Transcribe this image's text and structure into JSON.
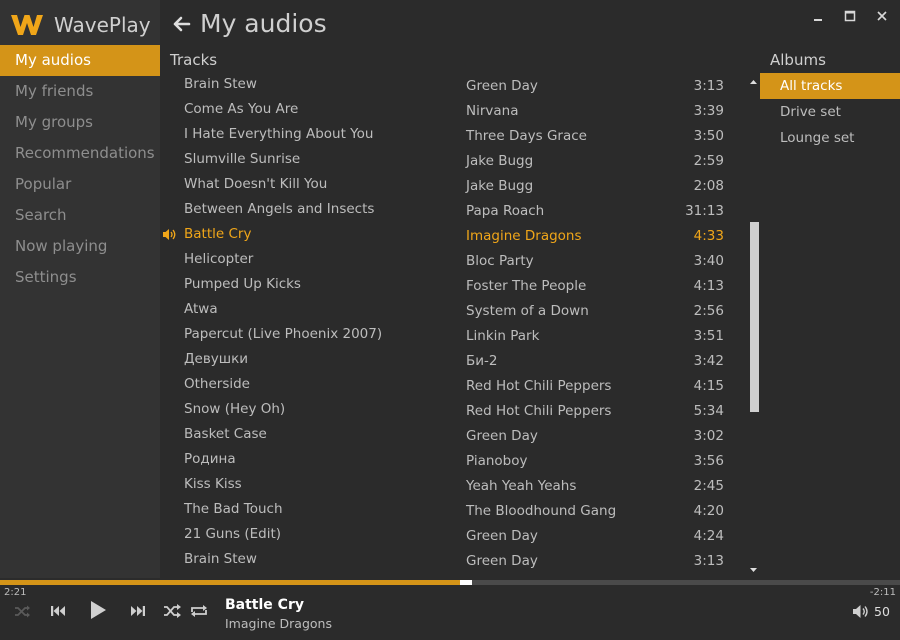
{
  "app": {
    "name": "WavePlay"
  },
  "window": {
    "minimize": "▬",
    "maximize": "□",
    "close": "✕"
  },
  "nav": [
    {
      "label": "My audios",
      "active": true
    },
    {
      "label": "My friends"
    },
    {
      "label": "My groups"
    },
    {
      "label": "Recommendations"
    },
    {
      "label": "Popular"
    },
    {
      "label": "Search"
    },
    {
      "label": "Now playing"
    },
    {
      "label": "Settings"
    }
  ],
  "page": {
    "title": "My audios",
    "tracks_heading": "Tracks",
    "albums_heading": "Albums"
  },
  "tracks_left": [
    "Brain Stew",
    "Come As You Are",
    "I Hate Everything About You",
    "Slumville Sunrise",
    "What Doesn't Kill You",
    "Between Angels and Insects",
    "Battle Cry",
    "Helicopter",
    "Pumped Up Kicks",
    "Atwa",
    "Papercut (Live Phoenix 2007)",
    "Девушки",
    "Otherside",
    "Snow (Hey Oh)",
    "Basket Case",
    "Родина",
    "Kiss Kiss",
    "The Bad Touch",
    "21 Guns (Edit)",
    "Brain Stew"
  ],
  "tracks_right": [
    {
      "artist": "Green Day",
      "duration": "3:13"
    },
    {
      "artist": "Nirvana",
      "duration": "3:39"
    },
    {
      "artist": "Three Days Grace",
      "duration": "3:50"
    },
    {
      "artist": "Jake Bugg",
      "duration": "2:59"
    },
    {
      "artist": "Jake Bugg",
      "duration": "2:08"
    },
    {
      "artist": "Papa Roach",
      "duration": "31:13"
    },
    {
      "artist": "Imagine Dragons",
      "duration": "4:33"
    },
    {
      "artist": "Bloc Party",
      "duration": "3:40"
    },
    {
      "artist": "Foster The People",
      "duration": "4:13"
    },
    {
      "artist": "System of a Down",
      "duration": "2:56"
    },
    {
      "artist": "Linkin Park",
      "duration": "3:51"
    },
    {
      "artist": "Би-2",
      "duration": "3:42"
    },
    {
      "artist": "Red Hot Chili Peppers",
      "duration": "4:15"
    },
    {
      "artist": "Red Hot Chili Peppers",
      "duration": "5:34"
    },
    {
      "artist": "Green Day",
      "duration": "3:02"
    },
    {
      "artist": "Pianoboy",
      "duration": "3:56"
    },
    {
      "artist": "Yeah Yeah Yeahs",
      "duration": "2:45"
    },
    {
      "artist": "The Bloodhound Gang",
      "duration": "4:20"
    },
    {
      "artist": "Green Day",
      "duration": "4:24"
    },
    {
      "artist": "Green Day",
      "duration": "3:13"
    }
  ],
  "playing_index": 6,
  "albums": [
    {
      "label": "All tracks",
      "active": true
    },
    {
      "label": "Drive set"
    },
    {
      "label": "Lounge set"
    }
  ],
  "player": {
    "elapsed": "2:21",
    "remaining": "-2:11",
    "progress_fraction": 0.518,
    "title": "Battle Cry",
    "artist": "Imagine Dragons",
    "volume": "50"
  },
  "colors": {
    "accent": "#d49418",
    "playing": "#f0a619"
  },
  "icons": [
    "back-arrow-icon",
    "speaker-icon",
    "shuffle-icon",
    "repeat-icon",
    "previous-icon",
    "play-icon",
    "next-icon",
    "volume-icon"
  ]
}
